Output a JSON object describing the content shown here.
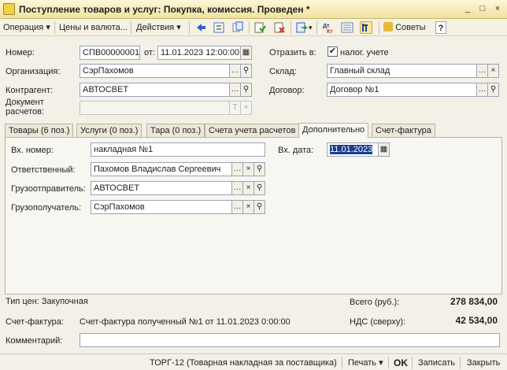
{
  "window": {
    "title": "Поступление товаров и услуг: Покупка, комиссия. Проведен *",
    "controls": [
      "_",
      "□",
      "×"
    ]
  },
  "toolbar": {
    "operation": "Операция",
    "prices": "Цены и валюта...",
    "actions": "Действия",
    "tips": "Советы",
    "help": "?"
  },
  "header": {
    "number_label": "Номер:",
    "number_value": "СПВ00000001",
    "from_label": "от:",
    "date_value": "11.01.2023 12:00:00",
    "reflect_label": "Отразить в:",
    "tax_accounting_label": "налог. учете",
    "tax_accounting_checked": true,
    "org_label": "Организация:",
    "org_value": "СэрПахомов",
    "warehouse_label": "Склад:",
    "warehouse_value": "Главный склад",
    "counterparty_label": "Контрагент:",
    "counterparty_value": "АВТОСВЕТ",
    "contract_label": "Договор:",
    "contract_value": "Договор №1",
    "settlement_doc_label_1": "Документ",
    "settlement_doc_label_2": "расчетов:",
    "settlement_doc_value": ""
  },
  "tabs": [
    {
      "label": "Товары (6 поз.)"
    },
    {
      "label": "Услуги (0 поз.)"
    },
    {
      "label": "Тара (0 поз.)"
    },
    {
      "label": "Счета учета расчетов"
    },
    {
      "label": "Дополнительно",
      "active": true
    },
    {
      "label": "Счет-фактура"
    }
  ],
  "additional": {
    "in_number_label": "Вх. номер:",
    "in_number_value": "накладная №1",
    "in_date_label": "Вх. дата:",
    "in_date_value": "11.01.2023",
    "responsible_label": "Ответственный:",
    "responsible_value": "Пахомов Владислав Сергеевич",
    "shipper_label": "Грузоотправитель:",
    "shipper_value": "АВТОСВЕТ",
    "consignee_label": "Грузополучатель:",
    "consignee_value": "СэрПахомов"
  },
  "footer": {
    "price_type": "Тип цен: Закупочная",
    "total_label": "Всего (руб.):",
    "total_value": "278 834,00",
    "invoice_label": "Счет-фактура:",
    "invoice_value": "Счет-фактура полученный №1 от 11.01.2023 0:00:00",
    "vat_label": "НДС (сверху):",
    "vat_value": "42 534,00",
    "comment_label": "Комментарий:",
    "comment_value": ""
  },
  "statusbar": {
    "torg": "ТОРГ-12 (Товарная накладная за поставщика)",
    "print": "Печать",
    "ok": "OK",
    "save": "Записать",
    "close": "Закрыть"
  },
  "colors": {
    "title_bg": "#efe2a0",
    "selected_text_bg": "#1a3d8f",
    "field_border": "#9aa4b3"
  }
}
